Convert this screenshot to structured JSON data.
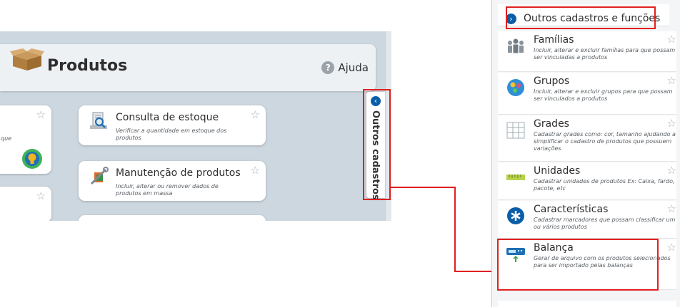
{
  "header": {
    "title": "Produtos",
    "help_label": "Ajuda",
    "help_icon": "?"
  },
  "side_tab": {
    "label": "Outros cadastros"
  },
  "cards": [
    {
      "name": "stock",
      "title": "Consulta de estoque",
      "desc": "Verificar a quantidade em estoque dos produtos"
    },
    {
      "name": "maintenance",
      "title": "Manutenção de produtos",
      "desc": "Incluir, alterar ou remover dados de produtos em massa"
    }
  ],
  "partial_card_text": "que",
  "star_glyph": "☆",
  "panel": {
    "title": "Outros cadastros e funções",
    "items": [
      {
        "title": "Famílias",
        "desc": "Incluir, alterar e excluir famílias para que possam ser vinculadas a produtos",
        "icon": "family-icon"
      },
      {
        "title": "Grupos",
        "desc": "Incluir, alterar e excluir grupos para que possam ser vinculados a produtos",
        "icon": "groups-icon"
      },
      {
        "title": "Grades",
        "desc": "Cadastrar grades como: cor, tamanho ajudando a simplificar o cadastro de produtos que possuem variações",
        "icon": "grid-icon"
      },
      {
        "title": "Unidades",
        "desc": "Cadastrar unidades de produtos   Ex: Caixa, fardo, pacote, etc",
        "icon": "ruler-icon"
      },
      {
        "title": "Características",
        "desc": "Cadastrar marcadores que possam classificar um ou vários produtos",
        "icon": "asterisk-icon"
      },
      {
        "title": "Balança",
        "desc": "Gerar de arquivo com os produtos selecionados para ser importado pelas balanças",
        "icon": "scale-icon"
      }
    ]
  },
  "colors": {
    "accent_blue": "#0a5ea8",
    "highlight_red": "#e02020",
    "app_bg": "#cdd7df"
  }
}
